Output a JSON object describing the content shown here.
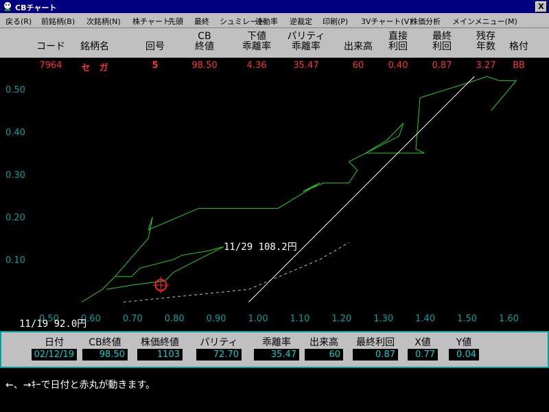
{
  "window": {
    "title": "CBチャート",
    "close_label": "X"
  },
  "menu": [
    {
      "label": "戻る(R)"
    },
    {
      "label": "前銘柄(B)"
    },
    {
      "label": "次銘柄(N)"
    },
    {
      "label": "株チャート"
    },
    {
      "label": "先頭"
    },
    {
      "label": "最終"
    },
    {
      "label": "シュミレート"
    },
    {
      "label": "連動率"
    },
    {
      "label": "逆裁定"
    },
    {
      "label": "印刷(P)"
    },
    {
      "label": "3Vチャート(V)"
    },
    {
      "label": "株価分析"
    },
    {
      "label": "メインメニュー(M)"
    }
  ],
  "header": [
    {
      "line1": "",
      "line2": "コード"
    },
    {
      "line1": "",
      "line2": "銘柄名"
    },
    {
      "line1": "",
      "line2": "回号"
    },
    {
      "line1": "CB",
      "line2": "終値"
    },
    {
      "line1": "下値",
      "line2": "乖離率"
    },
    {
      "line1": "パリティ",
      "line2": "乖離率"
    },
    {
      "line1": "",
      "line2": "出来高"
    },
    {
      "line1": "直接",
      "line2": "利回"
    },
    {
      "line1": "最終",
      "line2": "利回"
    },
    {
      "line1": "残存",
      "line2": "年数"
    },
    {
      "line1": "",
      "line2": "格付"
    }
  ],
  "values": [
    "7964",
    "セ　ガ",
    "5",
    "98.50",
    "4.36",
    "35.47",
    "60",
    "0.40",
    "0.87",
    "3.27",
    "BB"
  ],
  "annotations": {
    "current": "11/29 108.2円",
    "start": "11/19 92.0円"
  },
  "status_text": "←、→ｷｰで日付と赤丸が動きます。",
  "info": {
    "labels": [
      "日付",
      "CB終値",
      "株価終値",
      "パリティ",
      "乖離率",
      "出来高",
      "最終利回",
      "X値",
      "Y値"
    ],
    "values": [
      "02/12/19",
      "98.50",
      "1103",
      "72.70",
      "35.47",
      "60",
      "0.87",
      "0.77",
      "0.04"
    ]
  },
  "chart_data": {
    "type": "line",
    "x_ticks": [
      "0.50",
      "0.60",
      "0.70",
      "0.80",
      "0.90",
      "1.00",
      "1.10",
      "1.20",
      "1.30",
      "1.40",
      "1.50",
      "1.60"
    ],
    "y_ticks": [
      "0.50",
      "0.40",
      "0.30",
      "0.20",
      "0.10"
    ],
    "xlim": [
      0.5,
      1.6
    ],
    "ylim": [
      0.0,
      0.55
    ],
    "grid": false,
    "series": [
      {
        "color": "#20d020",
        "points": [
          [
            0.58,
            0.0
          ],
          [
            0.63,
            0.03
          ],
          [
            0.66,
            0.06
          ],
          [
            0.74,
            0.15
          ],
          [
            0.75,
            0.2
          ],
          [
            0.74,
            0.17
          ],
          [
            0.86,
            0.22
          ],
          [
            1.05,
            0.22
          ],
          [
            1.15,
            0.28
          ],
          [
            1.11,
            0.26
          ],
          [
            1.16,
            0.28
          ],
          [
            1.22,
            0.28
          ],
          [
            1.24,
            0.31
          ],
          [
            1.22,
            0.33
          ],
          [
            1.34,
            0.39
          ],
          [
            1.35,
            0.42
          ],
          [
            1.31,
            0.38
          ],
          [
            1.26,
            0.35
          ],
          [
            1.4,
            0.35
          ],
          [
            1.38,
            0.36
          ],
          [
            1.39,
            0.48
          ],
          [
            1.52,
            0.52
          ],
          [
            1.55,
            0.53
          ],
          [
            1.58,
            0.52
          ],
          [
            1.62,
            0.52
          ],
          [
            1.56,
            0.45
          ]
        ]
      },
      {
        "color": "#20d020",
        "points": [
          [
            0.66,
            0.06
          ],
          [
            0.7,
            0.06
          ],
          [
            0.72,
            0.08
          ],
          [
            0.8,
            0.1
          ],
          [
            0.82,
            0.11
          ],
          [
            0.88,
            0.12
          ],
          [
            0.92,
            0.13
          ],
          [
            0.8,
            0.07
          ],
          [
            0.78,
            0.05
          ],
          [
            0.7,
            0.04
          ],
          [
            0.64,
            0.03
          ]
        ]
      },
      {
        "color": "#ffffff",
        "points": [
          [
            0.98,
            0.0
          ],
          [
            1.52,
            0.53
          ]
        ]
      },
      {
        "color": "#c0c0c0",
        "dashed": true,
        "points": [
          [
            0.68,
            0.0
          ],
          [
            0.98,
            0.03
          ],
          [
            1.15,
            0.1
          ],
          [
            1.22,
            0.14
          ]
        ]
      }
    ],
    "marker": {
      "x": 0.77,
      "y": 0.04,
      "color": "#ff2020"
    }
  }
}
